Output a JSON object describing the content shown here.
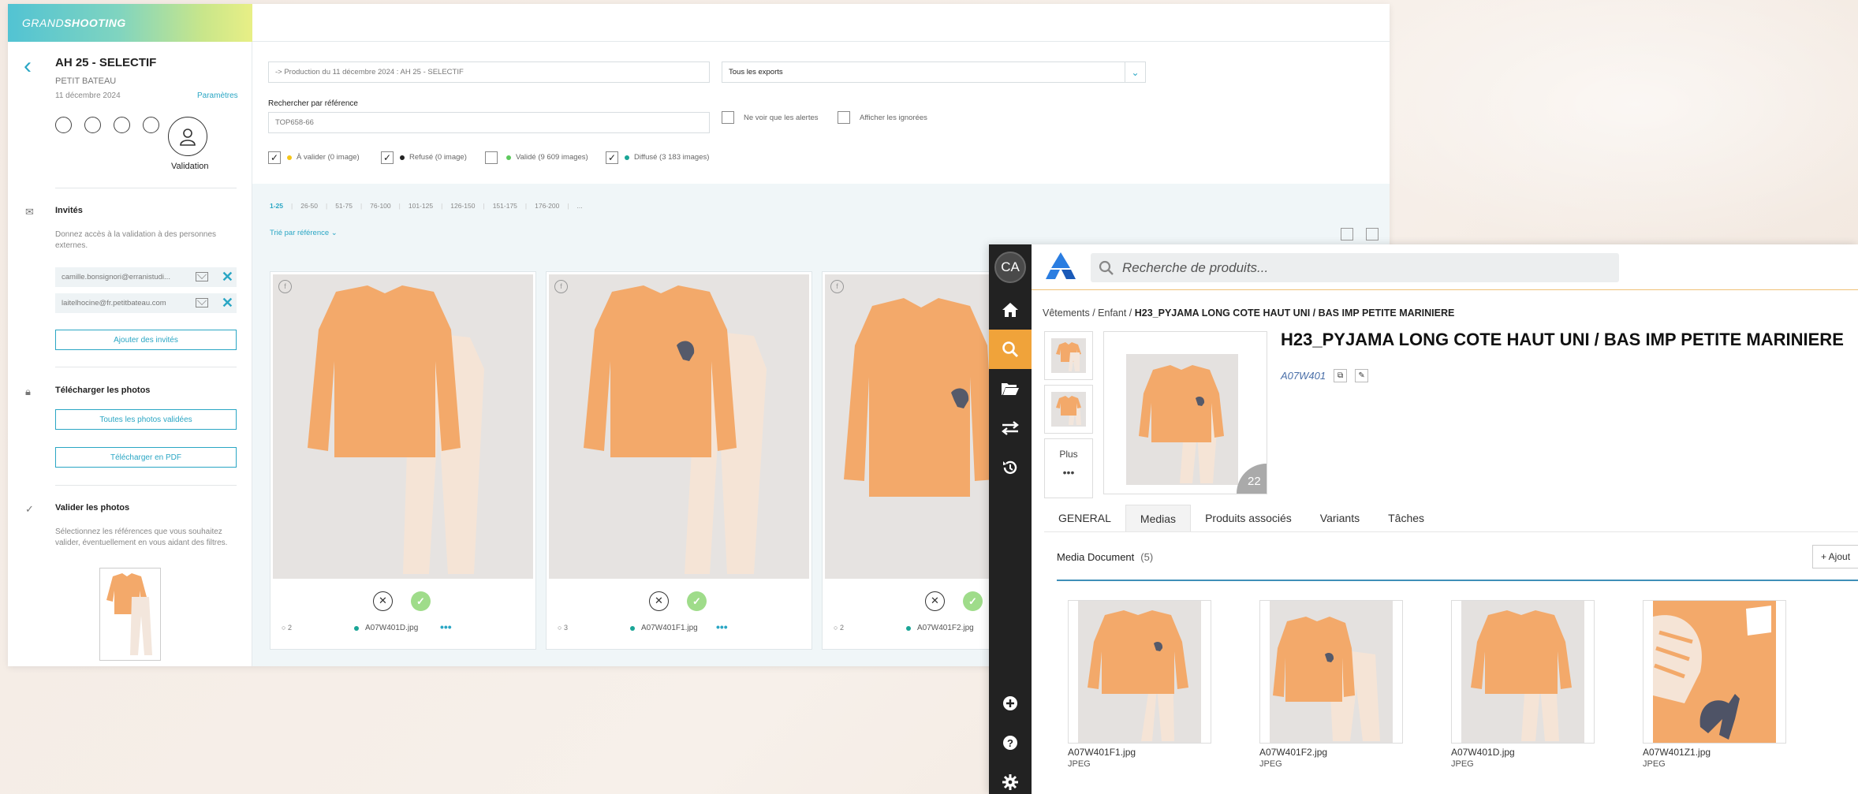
{
  "grandshooting": {
    "logo_light": "GRAND",
    "logo_bold": "SHOOTING",
    "title": "AH 25 - SELECTIF",
    "brand": "PETIT BATEAU",
    "date": "11 décembre 2024",
    "params_link": "Paramètres",
    "validation_label": "Validation",
    "invites": {
      "title": "Invités",
      "desc": "Donnez accès à la validation à des personnes externes.",
      "emails": [
        "camille.bonsignori@erranistudi...",
        "laitelhocine@fr.petitbateau.com"
      ],
      "add_button": "Ajouter des invités"
    },
    "download": {
      "title": "Télécharger les photos",
      "all_button": "Toutes les photos validées",
      "pdf_button": "Télécharger en PDF"
    },
    "validate": {
      "title": "Valider les photos",
      "desc": "Sélectionnez les références que vous souhaitez valider, éventuellement en vous aidant des filtres."
    },
    "filters": {
      "production": "-> Production du 11 décembre 2024 : AH 25 - SELECTIF",
      "exports": "Tous les exports",
      "search_label": "Rechercher par référence",
      "search_value": "TOP658-66",
      "alerts_only": "Ne voir que les alertes",
      "show_ignored": "Afficher les ignorées",
      "statuses": [
        {
          "label": "À valider (0 image)",
          "checked": true,
          "color": "#f5c518"
        },
        {
          "label": "Refusé (0 image)",
          "checked": true,
          "color": "#222222"
        },
        {
          "label": "Validé (9 609 images)",
          "checked": false,
          "color": "#5cc85c"
        },
        {
          "label": "Diffusé (3 183 images)",
          "checked": true,
          "color": "#1aa596"
        }
      ]
    },
    "pager": [
      "1-25",
      "26-50",
      "51-75",
      "76-100",
      "101-125",
      "126-150",
      "151-175",
      "176-200",
      "..."
    ],
    "sort_label": "Trié par référence",
    "cards": [
      {
        "comments": "2",
        "file": "A07W401D.jpg",
        "f": "f"
      },
      {
        "comments": "3",
        "file": "A07W401F1.jpg",
        "f": "f"
      },
      {
        "comments": "2",
        "file": "A07W401F2.jpg",
        "f": "f"
      }
    ]
  },
  "pim": {
    "avatar": "CA",
    "search_placeholder": "Recherche de produits...",
    "breadcrumb_prefix": "Vêtements / Enfant / ",
    "breadcrumb_current": "H23_PYJAMA LONG COTE HAUT UNI / BAS IMP PETITE MARINIERE",
    "title": "H23_PYJAMA LONG COTE HAUT UNI / BAS IMP PETITE MARINIERE",
    "ref": "A07W401",
    "plus_label": "Plus",
    "more_dots": "•••",
    "image_count": "22",
    "tabs": [
      "GENERAL",
      "Medias",
      "Produits associés",
      "Variants",
      "Tâches"
    ],
    "media_section": "Media Document",
    "media_count": "(5)",
    "add_label": "+ Ajout",
    "media": [
      {
        "name": "A07W401F1.jpg",
        "type": "JPEG"
      },
      {
        "name": "A07W401F2.jpg",
        "type": "JPEG"
      },
      {
        "name": "A07W401D.jpg",
        "type": "JPEG"
      },
      {
        "name": "A07W401Z1.jpg",
        "type": "JPEG"
      }
    ]
  },
  "colors": {
    "accent_teal": "#2aa6c4",
    "pim_orange": "#f0a33a",
    "garment_orange": "#f3a96a"
  }
}
